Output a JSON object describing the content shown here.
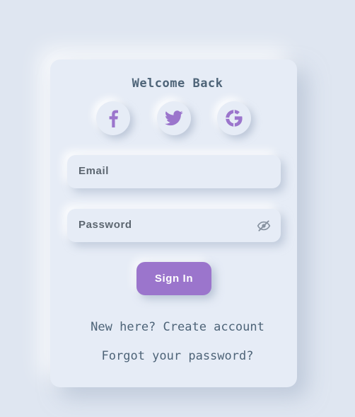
{
  "form": {
    "title": "Welcome Back",
    "social": [
      {
        "name": "facebook-icon"
      },
      {
        "name": "twitter-icon"
      },
      {
        "name": "google-icon"
      }
    ],
    "email_placeholder": "Email",
    "password_placeholder": "Password",
    "toggle_icon": "eye-slash-icon",
    "signin_label": "Sign In",
    "create_account_link": "New here? Create account",
    "forgot_password_link": "Forgot your password?"
  },
  "colors": {
    "background": "#dfe6f1",
    "card": "#e6ecf6",
    "accent": "#9b75cc",
    "text": "#4e6478",
    "label": "#5c6670"
  }
}
